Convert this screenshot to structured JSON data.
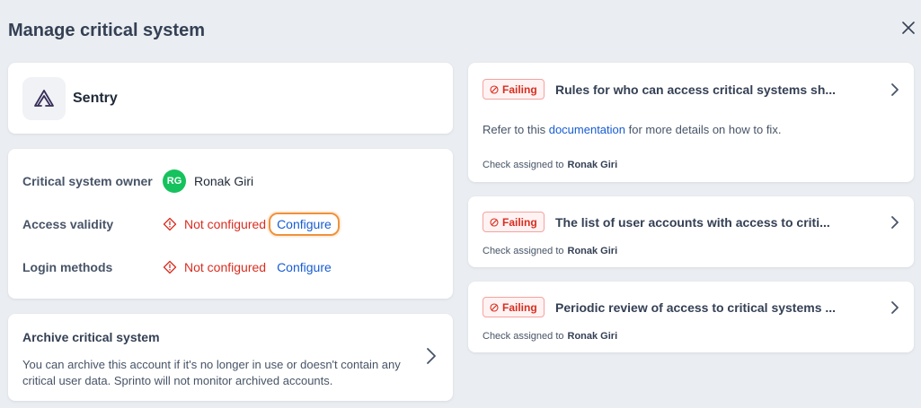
{
  "header": {
    "title": "Manage critical system"
  },
  "system": {
    "name": "Sentry"
  },
  "details": {
    "owner_label": "Critical system owner",
    "owner_initials": "RG",
    "owner_name": "Ronak Giri",
    "access_label": "Access validity",
    "access_status": "Not configured",
    "access_action": "Configure",
    "login_label": "Login methods",
    "login_status": "Not configured",
    "login_action": "Configure"
  },
  "archive": {
    "title": "Archive critical system",
    "description": "You can archive this account if it's no longer in use or doesn't contain any critical user data. Sprinto will not monitor archived accounts."
  },
  "checks": [
    {
      "status": "Failing",
      "title": "Rules for who can access critical systems sh...",
      "refer_prefix": "Refer to this",
      "refer_link": "documentation",
      "refer_suffix": "for more details on how to fix.",
      "assigned_label": "Check assigned to",
      "assignee": "Ronak Giri"
    },
    {
      "status": "Failing",
      "title": "The list of user accounts with access to criti...",
      "assigned_label": "Check assigned to",
      "assignee": "Ronak Giri"
    },
    {
      "status": "Failing",
      "title": "Periodic review of access to critical systems ...",
      "assigned_label": "Check assigned to",
      "assignee": "Ronak Giri"
    }
  ],
  "colors": {
    "background": "#eaedf1",
    "failing": "#d92d20",
    "link": "#175cd3",
    "avatar": "#16c25d",
    "highlight": "#f0923a"
  }
}
